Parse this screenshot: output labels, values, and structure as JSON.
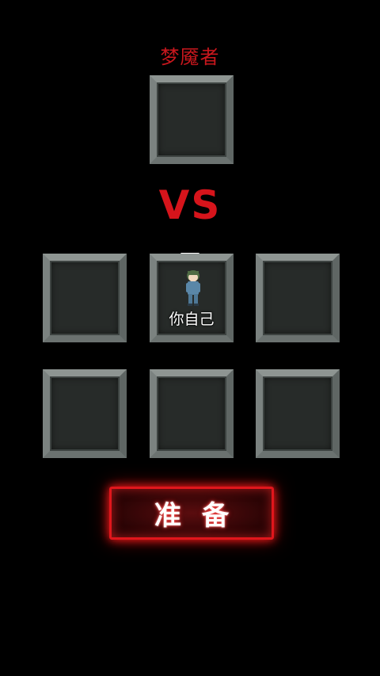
{
  "header": {
    "title": "梦魇者"
  },
  "versus": {
    "label": "VS"
  },
  "party": {
    "player_label": "你自己"
  },
  "actions": {
    "ready_label": "准备"
  },
  "colors": {
    "accent_red": "#d6141b",
    "slot_fill": "#272b29",
    "slot_frame": "#8e9592"
  }
}
